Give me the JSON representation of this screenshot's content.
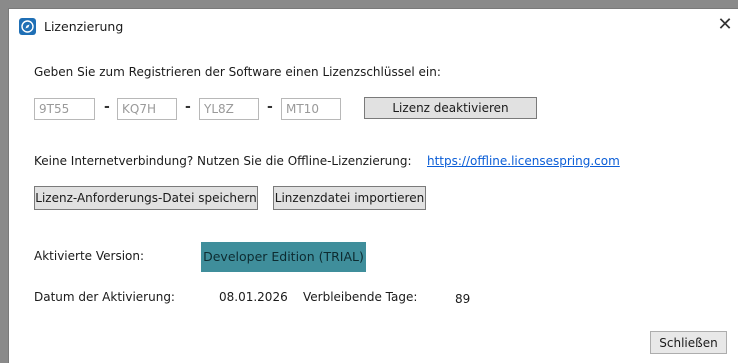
{
  "window": {
    "title": "Lizenzierung"
  },
  "instructions": "Geben Sie zum Registrieren der Software einen Lizenzschlüssel ein:",
  "license_key": {
    "parts": [
      "9T55",
      "KQ7H",
      "YL8Z",
      "MT10"
    ],
    "separator": "-"
  },
  "buttons": {
    "deactivate": "Lizenz deaktivieren",
    "save_request": "Lizenz-Anforderungs-Datei speichern",
    "import_file": "Linzenzdatei importieren",
    "close": "Schließen"
  },
  "offline": {
    "prompt": "Keine Internetverbindung? Nutzen Sie die Offline-Lizenzierung:",
    "link": "https://offline.licensespring.com"
  },
  "status": {
    "version_label": "Aktivierte Version:",
    "version_value": "Developer Edition (TRIAL)",
    "date_label": "Datum der Aktivierung:",
    "date_value": "08.01.2026",
    "days_label": "Verbleibende Tage:",
    "days_value": "89"
  },
  "colors": {
    "badge": "#3f8e9b",
    "link": "#0b5ed7",
    "app_icon": "#1f6fb5"
  }
}
